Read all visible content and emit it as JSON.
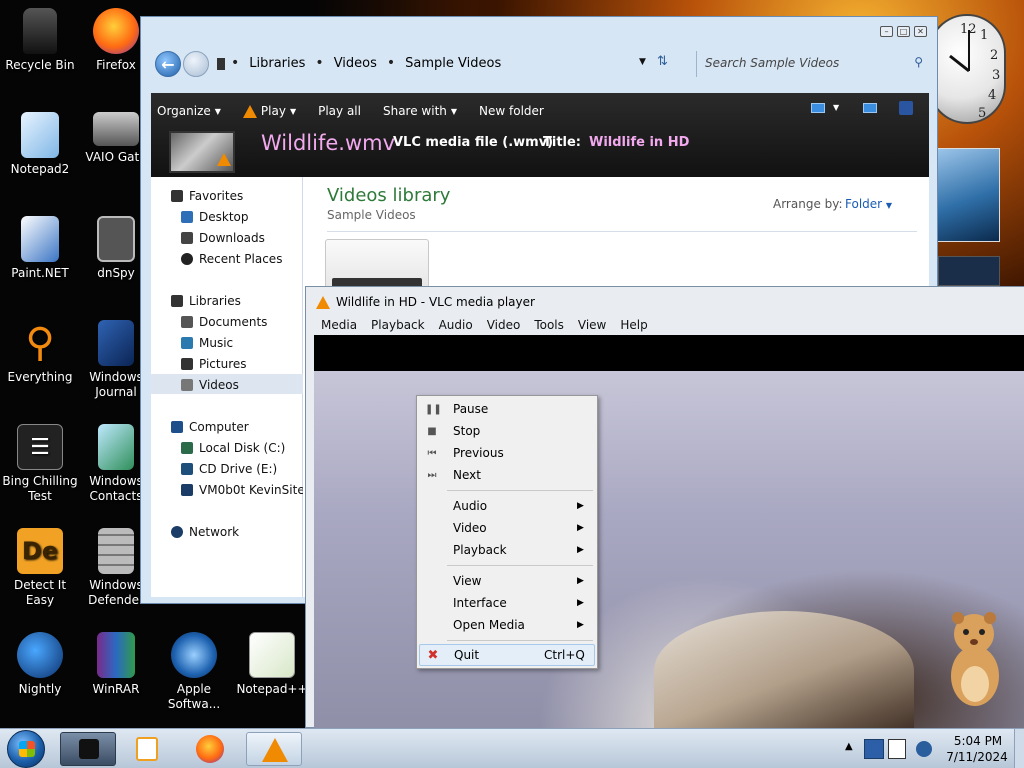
{
  "desktop": {
    "icons": [
      {
        "label": "Recycle Bin",
        "icon": "recycle-bin-icon"
      },
      {
        "label": "Firefox",
        "icon": "firefox-icon"
      },
      {
        "label": "Notepad2",
        "icon": "notepad2-icon"
      },
      {
        "label": "VAIO Gate",
        "icon": "vaio-gate-icon"
      },
      {
        "label": "Paint.NET",
        "icon": "paint-net-icon"
      },
      {
        "label": "dnSpy",
        "icon": "dnspy-icon"
      },
      {
        "label": "Everything",
        "icon": "everything-search-icon"
      },
      {
        "label": "Windows Journal",
        "icon": "windows-journal-icon"
      },
      {
        "label": "Bing Chilling Test",
        "icon": "text-file-icon"
      },
      {
        "label": "Windows Contacts",
        "icon": "windows-contacts-icon"
      },
      {
        "label": "Detect It Easy",
        "icon": "detect-it-easy-icon"
      },
      {
        "label": "Windows Defender",
        "icon": "windows-defender-icon"
      },
      {
        "label": "Nightly",
        "icon": "nightly-icon"
      },
      {
        "label": "WinRAR",
        "icon": "winrar-icon"
      },
      {
        "label": "Apple Softwa...",
        "icon": "apple-software-update-icon"
      },
      {
        "label": "Notepad++",
        "icon": "notepad-plus-plus-icon"
      }
    ],
    "clock_gadget": {
      "numbers": [
        "12",
        "1",
        "2",
        "3",
        "4",
        "5"
      ]
    }
  },
  "explorer": {
    "breadcrumbs": [
      "Libraries",
      "Videos",
      "Sample Videos"
    ],
    "search_placeholder": "Search Sample Videos",
    "commands": [
      "Organize",
      "Play",
      "Play all",
      "Share with",
      "New folder"
    ],
    "media": {
      "name": "Wildlife.wmv",
      "type": "VLC media file (.wmv)",
      "title_label": "Title:",
      "title_value": "Wildlife in HD"
    },
    "nav": {
      "favorites_label": "Favorites",
      "favorites": [
        "Desktop",
        "Downloads",
        "Recent Places"
      ],
      "libraries_label": "Libraries",
      "libraries": [
        "Documents",
        "Music",
        "Pictures",
        "Videos"
      ],
      "computer_label": "Computer",
      "computer": [
        "Local Disk (C:)",
        "CD Drive (E:)",
        "VM0b0t KevinSite"
      ],
      "network_label": "Network"
    },
    "content": {
      "title": "Videos library",
      "subtitle": "Sample Videos",
      "arrange_label": "Arrange by:",
      "arrange_value": "Folder"
    }
  },
  "vlc": {
    "title": "Wildlife in HD - VLC media player",
    "menus": [
      "Media",
      "Playback",
      "Audio",
      "Video",
      "Tools",
      "View",
      "Help"
    ],
    "context_menu": {
      "pause": "Pause",
      "stop": "Stop",
      "previous": "Previous",
      "next": "Next",
      "audio": "Audio",
      "video": "Video",
      "playback": "Playback",
      "view": "View",
      "interface": "Interface",
      "open_media": "Open Media",
      "quit": "Quit",
      "quit_shortcut": "Ctrl+Q"
    }
  },
  "taskbar": {
    "time": "5:04 PM",
    "date": "7/11/2024"
  },
  "colors": {
    "vlc_orange": "#f08a00",
    "explorer_toolbar": "#1a1a1a",
    "library_title_green": "#2e7a3a",
    "media_pink": "#f2a9ee"
  }
}
